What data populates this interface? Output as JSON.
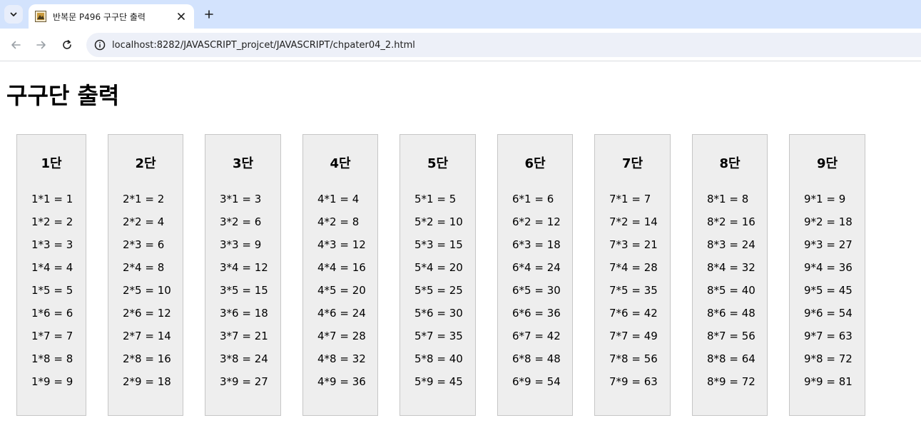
{
  "browser": {
    "tab_title": "반복문 P496 구구단 출력",
    "url": "localhost:8282/JAVASCRIPT_projcet/JAVASCRIPT/chpater04_2.html"
  },
  "page": {
    "title": "구구단 출력"
  },
  "tables": [
    {
      "title": "1단",
      "rows": [
        "1*1 = 1",
        "1*2 = 2",
        "1*3 = 3",
        "1*4 = 4",
        "1*5 = 5",
        "1*6 = 6",
        "1*7 = 7",
        "1*8 = 8",
        "1*9 = 9"
      ]
    },
    {
      "title": "2단",
      "rows": [
        "2*1 = 2",
        "2*2 = 4",
        "2*3 = 6",
        "2*4 = 8",
        "2*5 = 10",
        "2*6 = 12",
        "2*7 = 14",
        "2*8 = 16",
        "2*9 = 18"
      ]
    },
    {
      "title": "3단",
      "rows": [
        "3*1 = 3",
        "3*2 = 6",
        "3*3 = 9",
        "3*4 = 12",
        "3*5 = 15",
        "3*6 = 18",
        "3*7 = 21",
        "3*8 = 24",
        "3*9 = 27"
      ]
    },
    {
      "title": "4단",
      "rows": [
        "4*1 = 4",
        "4*2 = 8",
        "4*3 = 12",
        "4*4 = 16",
        "4*5 = 20",
        "4*6 = 24",
        "4*7 = 28",
        "4*8 = 32",
        "4*9 = 36"
      ]
    },
    {
      "title": "5단",
      "rows": [
        "5*1 = 5",
        "5*2 = 10",
        "5*3 = 15",
        "5*4 = 20",
        "5*5 = 25",
        "5*6 = 30",
        "5*7 = 35",
        "5*8 = 40",
        "5*9 = 45"
      ]
    },
    {
      "title": "6단",
      "rows": [
        "6*1 = 6",
        "6*2 = 12",
        "6*3 = 18",
        "6*4 = 24",
        "6*5 = 30",
        "6*6 = 36",
        "6*7 = 42",
        "6*8 = 48",
        "6*9 = 54"
      ]
    },
    {
      "title": "7단",
      "rows": [
        "7*1 = 7",
        "7*2 = 14",
        "7*3 = 21",
        "7*4 = 28",
        "7*5 = 35",
        "7*6 = 42",
        "7*7 = 49",
        "7*8 = 56",
        "7*9 = 63"
      ]
    },
    {
      "title": "8단",
      "rows": [
        "8*1 = 8",
        "8*2 = 16",
        "8*3 = 24",
        "8*4 = 32",
        "8*5 = 40",
        "8*6 = 48",
        "8*7 = 56",
        "8*8 = 64",
        "8*9 = 72"
      ]
    },
    {
      "title": "9단",
      "rows": [
        "9*1 = 9",
        "9*2 = 18",
        "9*3 = 27",
        "9*4 = 36",
        "9*5 = 45",
        "9*6 = 54",
        "9*7 = 63",
        "9*8 = 72",
        "9*9 = 81"
      ]
    }
  ]
}
